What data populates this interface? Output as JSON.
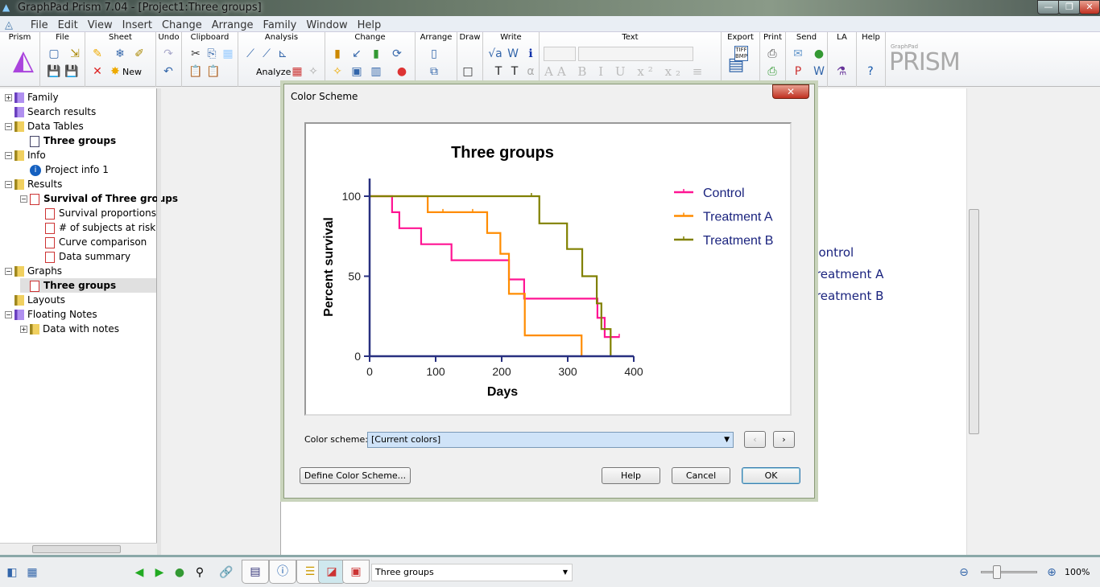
{
  "window": {
    "title": "GraphPad Prism 7.04 - [Project1:Three groups]"
  },
  "menu": [
    "File",
    "Edit",
    "View",
    "Insert",
    "Change",
    "Arrange",
    "Family",
    "Window",
    "Help"
  ],
  "ribbon": {
    "groups": [
      "Prism",
      "File",
      "Sheet",
      "Undo",
      "Clipboard",
      "Analysis",
      "Change",
      "Arrange",
      "Draw",
      "Write",
      "Text",
      "Export",
      "Print",
      "Send",
      "LA",
      "Help"
    ],
    "new_label": "New",
    "analyze_label": "Analyze",
    "export_badge": "TIFF BMP",
    "logo_small": "GraphPad",
    "logo": "PRISM"
  },
  "navigator": [
    {
      "label": "Family",
      "level": 0,
      "type": "folder-purple",
      "expander": "+"
    },
    {
      "label": "Search results",
      "level": 0,
      "type": "folder-purple"
    },
    {
      "label": "Data Tables",
      "level": 0,
      "type": "folder",
      "expander": "-"
    },
    {
      "label": "Three groups",
      "level": 1,
      "type": "table",
      "bold": true
    },
    {
      "label": "Info",
      "level": 0,
      "type": "folder",
      "expander": "-"
    },
    {
      "label": "Project info 1",
      "level": 1,
      "type": "info"
    },
    {
      "label": "Results",
      "level": 0,
      "type": "folder",
      "expander": "-"
    },
    {
      "label": "Survival of Three groups",
      "level": 1,
      "type": "result",
      "bold": true,
      "expander": "-"
    },
    {
      "label": "Survival proportions",
      "level": 2,
      "type": "result"
    },
    {
      "label": "# of subjects at risk",
      "level": 2,
      "type": "result"
    },
    {
      "label": "Curve comparison",
      "level": 2,
      "type": "result"
    },
    {
      "label": "Data summary",
      "level": 2,
      "type": "result"
    },
    {
      "label": "Graphs",
      "level": 0,
      "type": "folder",
      "expander": "-"
    },
    {
      "label": "Three groups",
      "level": 1,
      "type": "graph",
      "bold": true,
      "selected": true
    },
    {
      "label": "Layouts",
      "level": 0,
      "type": "folder"
    },
    {
      "label": "Floating Notes",
      "level": 0,
      "type": "folder-purple",
      "expander": "-"
    },
    {
      "label": "Data with notes",
      "level": 1,
      "type": "folder",
      "expander": "+"
    }
  ],
  "background_legend": [
    "Control",
    "Treatment A",
    "Treatment B"
  ],
  "dialog": {
    "title": "Color Scheme",
    "color_scheme_label": "Color scheme:",
    "color_scheme_value": "[Current colors]",
    "define_button": "Define Color Scheme...",
    "help_button": "Help",
    "cancel_button": "Cancel",
    "ok_button": "OK"
  },
  "chart_data": {
    "type": "line",
    "subtype": "survival-step",
    "title": "Three groups",
    "xlabel": "Days",
    "ylabel": "Percent survival",
    "xlim": [
      0,
      400
    ],
    "ylim": [
      0,
      100
    ],
    "xticks": [
      0,
      100,
      200,
      300,
      400
    ],
    "yticks": [
      0,
      50,
      100
    ],
    "grid": false,
    "legend_position": "right",
    "series": [
      {
        "name": "Control",
        "color": "#ff1493",
        "steps": [
          [
            0,
            100
          ],
          [
            34,
            90
          ],
          [
            45,
            80
          ],
          [
            78,
            70
          ],
          [
            124,
            60
          ],
          [
            211,
            48
          ],
          [
            234,
            36
          ],
          [
            345,
            24
          ],
          [
            356,
            12
          ],
          [
            378,
            12
          ]
        ],
        "censored": [
          [
            378,
            12
          ]
        ]
      },
      {
        "name": "Treatment A",
        "color": "#ff8c00",
        "steps": [
          [
            0,
            100
          ],
          [
            88,
            90
          ],
          [
            178,
            77
          ],
          [
            198,
            64
          ],
          [
            211,
            39
          ],
          [
            235,
            13
          ],
          [
            321,
            0
          ]
        ],
        "censored": [
          [
            111,
            90
          ],
          [
            156,
            90
          ]
        ]
      },
      {
        "name": "Treatment B",
        "color": "#808000",
        "steps": [
          [
            0,
            100
          ],
          [
            257,
            83
          ],
          [
            299,
            67
          ],
          [
            322,
            50
          ],
          [
            344,
            33
          ],
          [
            351,
            17
          ],
          [
            365,
            0
          ]
        ],
        "censored": [
          [
            245,
            100
          ]
        ]
      }
    ],
    "axis_color": "#283080"
  },
  "statusbar": {
    "sheet_select": "Three groups",
    "zoom": "100%"
  }
}
